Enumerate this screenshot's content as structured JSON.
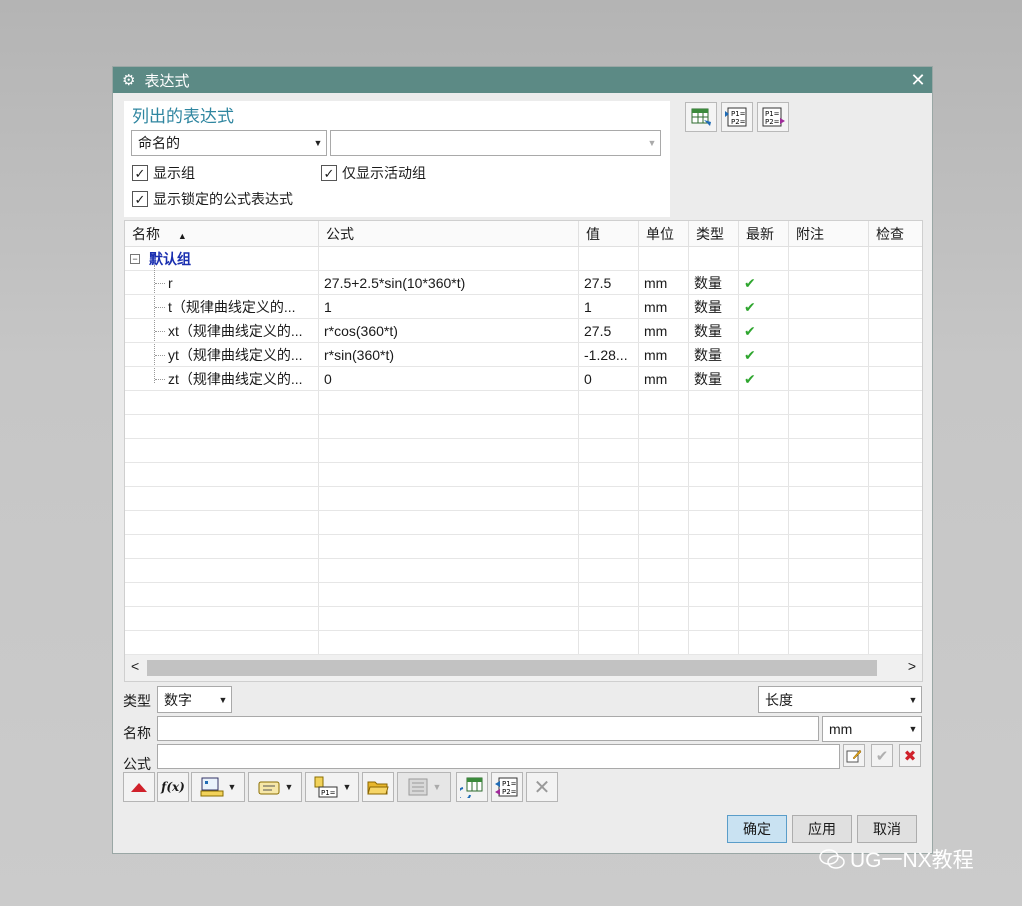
{
  "dialog": {
    "title": "表达式",
    "close_symbol": "✕"
  },
  "listed_panel": {
    "title": "列出的表达式",
    "filter_select": "命名的",
    "filter_text": "",
    "checkboxes": {
      "show_groups": {
        "label": "显示组",
        "checked": true
      },
      "active_groups_only": {
        "label": "仅显示活动组",
        "checked": true
      },
      "show_locked": {
        "label": "显示锁定的公式表达式",
        "checked": true
      }
    }
  },
  "top_toolbar": {
    "icons": [
      "spreadsheet-edit-icon",
      "export-expressions-icon",
      "import-expressions-icon"
    ]
  },
  "table": {
    "columns": [
      "名称",
      "公式",
      "值",
      "单位",
      "类型",
      "最新",
      "附注",
      "检查"
    ],
    "sort_indicator": "▲",
    "group": {
      "toggle": "−",
      "label": "默认组"
    },
    "rows": [
      {
        "name": "r",
        "formula": "27.5+2.5*sin(10*360*t)",
        "value": "27.5",
        "unit": "mm",
        "type": "数量",
        "uptodate": "✔"
      },
      {
        "name": "t（规律曲线定义的...",
        "formula": "1",
        "value": "1",
        "unit": "mm",
        "type": "数量",
        "uptodate": "✔"
      },
      {
        "name": "xt（规律曲线定义的...",
        "formula": "r*cos(360*t)",
        "value": "27.5",
        "unit": "mm",
        "type": "数量",
        "uptodate": "✔"
      },
      {
        "name": "yt（规律曲线定义的...",
        "formula": "r*sin(360*t)",
        "value": "-1.28...",
        "unit": "mm",
        "type": "数量",
        "uptodate": "✔"
      },
      {
        "name": "zt（规律曲线定义的...",
        "formula": "0",
        "value": "0",
        "unit": "mm",
        "type": "数量",
        "uptodate": "✔"
      }
    ],
    "scroll_left": "<",
    "scroll_right": ">"
  },
  "editor": {
    "type_label": "类型",
    "type_value": "数字",
    "dimension_value": "长度",
    "name_label": "名称",
    "name_value": "",
    "unit_value": "mm",
    "formula_label": "公式",
    "formula_value": ""
  },
  "bottom_toolbar": {
    "icons": [
      "red-triangle-icon",
      "function-icon",
      "measure-icon",
      "reference-icon",
      "functions-param-icon",
      "open-folder-icon",
      "list-icon",
      "refresh-spreadsheet-icon",
      "import-export-icon",
      "delete-icon"
    ],
    "function_label": "f(x)"
  },
  "actions": {
    "ok": "确定",
    "apply": "应用",
    "cancel": "取消"
  },
  "watermark": {
    "text": "UG一NX教程"
  }
}
